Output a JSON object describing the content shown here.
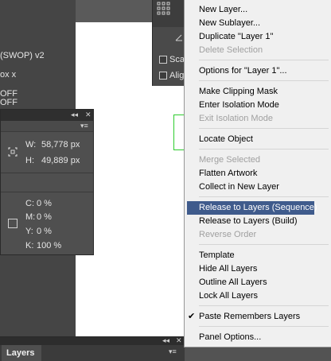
{
  "left_texts": {
    "profile": "(SWOP) v2",
    "line2": "ox x",
    "line3": "OFF",
    "line4": "OFF"
  },
  "info_panel": {
    "collapse_icon": "double-left-arrows-icon",
    "close_icon": "close-icon",
    "menu_icon": "panel-menu-icon",
    "w_label": "W:",
    "w_value": "58,778 px",
    "h_label": "H:",
    "h_value": "49,889 px",
    "c_label": "C:",
    "c_value": "0 %",
    "m_label": "M:",
    "m_value": "0 %",
    "y_label": "Y:",
    "y_value": "0 %",
    "k_label": "K:",
    "k_value": "100 %"
  },
  "mini_panel": {
    "scale_label": "Sca",
    "align_label": "Alig"
  },
  "layers_panel": {
    "tab_label": "Layers"
  },
  "menu": {
    "items": [
      {
        "label": "New Layer...",
        "disabled": false
      },
      {
        "label": "New Sublayer...",
        "disabled": false
      },
      {
        "label": "Duplicate \"Layer 1\"",
        "disabled": false
      },
      {
        "label": "Delete Selection",
        "disabled": true
      },
      {
        "label": "Options for \"Layer 1\"...",
        "disabled": false
      },
      {
        "label": "Make Clipping Mask",
        "disabled": false
      },
      {
        "label": "Enter Isolation Mode",
        "disabled": false
      },
      {
        "label": "Exit Isolation Mode",
        "disabled": true
      },
      {
        "label": "Locate Object",
        "disabled": false
      },
      {
        "label": "Merge Selected",
        "disabled": true
      },
      {
        "label": "Flatten Artwork",
        "disabled": false
      },
      {
        "label": "Collect in New Layer",
        "disabled": false
      },
      {
        "label": "Release to Layers (Sequence)",
        "disabled": false,
        "highlighted": true
      },
      {
        "label": "Release to Layers (Build)",
        "disabled": false
      },
      {
        "label": "Reverse Order",
        "disabled": true
      },
      {
        "label": "Template",
        "disabled": false
      },
      {
        "label": "Hide All Layers",
        "disabled": false
      },
      {
        "label": "Outline All Layers",
        "disabled": false
      },
      {
        "label": "Lock All Layers",
        "disabled": false
      },
      {
        "label": "Paste Remembers Layers",
        "disabled": false,
        "checked": true
      },
      {
        "label": "Panel Options...",
        "disabled": false
      }
    ]
  }
}
